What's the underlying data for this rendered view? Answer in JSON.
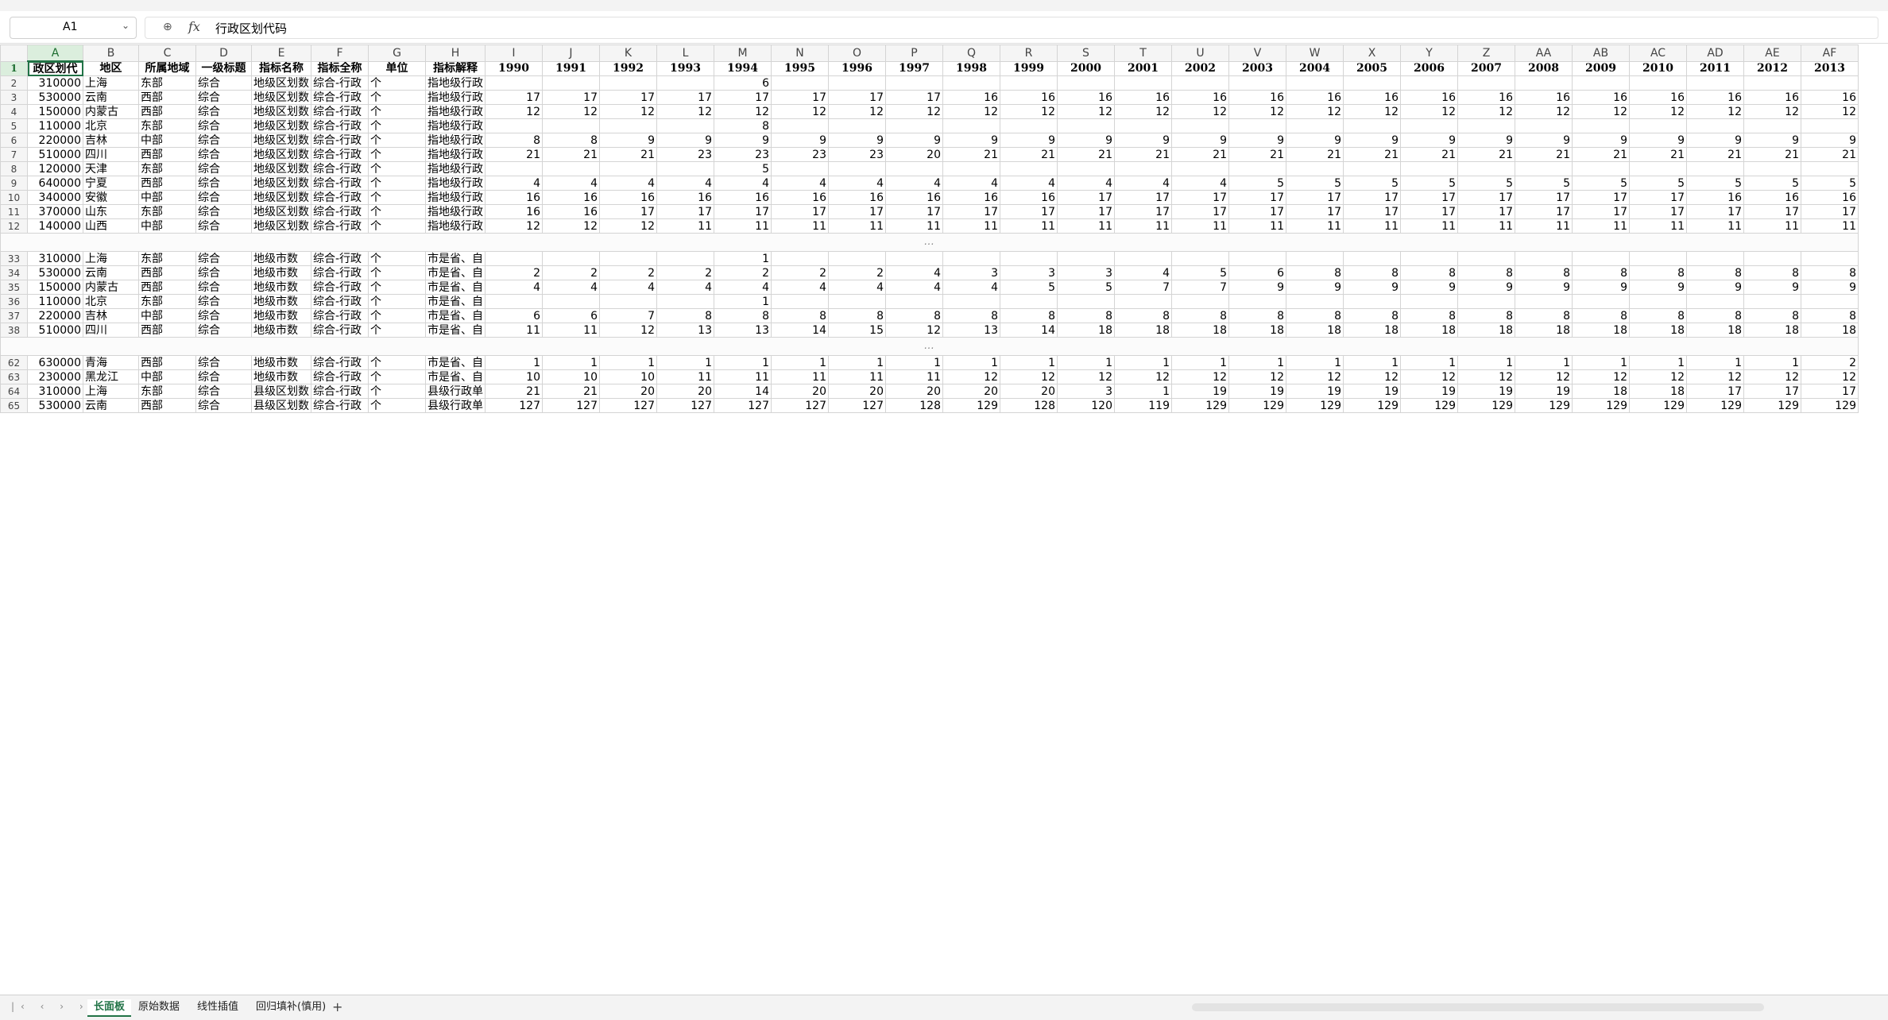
{
  "formula": {
    "cell_ref": "A1",
    "value": "行政区划代码"
  },
  "columns": [
    "A",
    "B",
    "C",
    "D",
    "E",
    "F",
    "G",
    "H",
    "I",
    "J",
    "K",
    "L",
    "M",
    "N",
    "O",
    "P",
    "Q",
    "R",
    "S",
    "T",
    "U",
    "V",
    "W",
    "X",
    "Y",
    "Z",
    "AA",
    "AB",
    "AC",
    "AD",
    "AE",
    "AF"
  ],
  "header_row": [
    "政区划代",
    "地区",
    "所属地域",
    "一级标题",
    "指标名称",
    "指标全称",
    "单位",
    "指标解释",
    "1990",
    "1991",
    "1992",
    "1993",
    "1994",
    "1995",
    "1996",
    "1997",
    "1998",
    "1999",
    "2000",
    "2001",
    "2002",
    "2003",
    "2004",
    "2005",
    "2006",
    "2007",
    "2008",
    "2009",
    "2010",
    "2011",
    "2012",
    "2013"
  ],
  "rows": [
    {
      "n": "2",
      "c": [
        "310000",
        "上海",
        "东部",
        "综合",
        "地级区划数",
        "综合-行政",
        "个",
        "指地级行政",
        "",
        "",
        "",
        "",
        "6",
        "",
        "",
        "",
        "",
        "",
        "",
        "",
        "",
        "",
        "",
        "",
        "",
        "",
        "",
        "",
        "",
        "",
        "",
        ""
      ]
    },
    {
      "n": "3",
      "c": [
        "530000",
        "云南",
        "西部",
        "综合",
        "地级区划数",
        "综合-行政",
        "个",
        "指地级行政",
        "17",
        "17",
        "17",
        "17",
        "17",
        "17",
        "17",
        "17",
        "16",
        "16",
        "16",
        "16",
        "16",
        "16",
        "16",
        "16",
        "16",
        "16",
        "16",
        "16",
        "16",
        "16",
        "16",
        "16"
      ]
    },
    {
      "n": "4",
      "c": [
        "150000",
        "内蒙古",
        "西部",
        "综合",
        "地级区划数",
        "综合-行政",
        "个",
        "指地级行政",
        "12",
        "12",
        "12",
        "12",
        "12",
        "12",
        "12",
        "12",
        "12",
        "12",
        "12",
        "12",
        "12",
        "12",
        "12",
        "12",
        "12",
        "12",
        "12",
        "12",
        "12",
        "12",
        "12",
        "12"
      ]
    },
    {
      "n": "5",
      "c": [
        "110000",
        "北京",
        "东部",
        "综合",
        "地级区划数",
        "综合-行政",
        "个",
        "指地级行政",
        "",
        "",
        "",
        "",
        "8",
        "",
        "",
        "",
        "",
        "",
        "",
        "",
        "",
        "",
        "",
        "",
        "",
        "",
        "",
        "",
        "",
        "",
        "",
        ""
      ]
    },
    {
      "n": "6",
      "c": [
        "220000",
        "吉林",
        "中部",
        "综合",
        "地级区划数",
        "综合-行政",
        "个",
        "指地级行政",
        "8",
        "8",
        "9",
        "9",
        "9",
        "9",
        "9",
        "9",
        "9",
        "9",
        "9",
        "9",
        "9",
        "9",
        "9",
        "9",
        "9",
        "9",
        "9",
        "9",
        "9",
        "9",
        "9",
        "9"
      ]
    },
    {
      "n": "7",
      "c": [
        "510000",
        "四川",
        "西部",
        "综合",
        "地级区划数",
        "综合-行政",
        "个",
        "指地级行政",
        "21",
        "21",
        "21",
        "23",
        "23",
        "23",
        "23",
        "20",
        "21",
        "21",
        "21",
        "21",
        "21",
        "21",
        "21",
        "21",
        "21",
        "21",
        "21",
        "21",
        "21",
        "21",
        "21",
        "21"
      ]
    },
    {
      "n": "8",
      "c": [
        "120000",
        "天津",
        "东部",
        "综合",
        "地级区划数",
        "综合-行政",
        "个",
        "指地级行政",
        "",
        "",
        "",
        "",
        "5",
        "",
        "",
        "",
        "",
        "",
        "",
        "",
        "",
        "",
        "",
        "",
        "",
        "",
        "",
        "",
        "",
        "",
        "",
        ""
      ]
    },
    {
      "n": "9",
      "c": [
        "640000",
        "宁夏",
        "西部",
        "综合",
        "地级区划数",
        "综合-行政",
        "个",
        "指地级行政",
        "4",
        "4",
        "4",
        "4",
        "4",
        "4",
        "4",
        "4",
        "4",
        "4",
        "4",
        "4",
        "4",
        "5",
        "5",
        "5",
        "5",
        "5",
        "5",
        "5",
        "5",
        "5",
        "5",
        "5"
      ]
    },
    {
      "n": "10",
      "c": [
        "340000",
        "安徽",
        "中部",
        "综合",
        "地级区划数",
        "综合-行政",
        "个",
        "指地级行政",
        "16",
        "16",
        "16",
        "16",
        "16",
        "16",
        "16",
        "16",
        "16",
        "16",
        "17",
        "17",
        "17",
        "17",
        "17",
        "17",
        "17",
        "17",
        "17",
        "17",
        "17",
        "16",
        "16",
        "16"
      ]
    },
    {
      "n": "11",
      "c": [
        "370000",
        "山东",
        "东部",
        "综合",
        "地级区划数",
        "综合-行政",
        "个",
        "指地级行政",
        "16",
        "16",
        "17",
        "17",
        "17",
        "17",
        "17",
        "17",
        "17",
        "17",
        "17",
        "17",
        "17",
        "17",
        "17",
        "17",
        "17",
        "17",
        "17",
        "17",
        "17",
        "17",
        "17",
        "17"
      ]
    },
    {
      "n": "12",
      "c": [
        "140000",
        "山西",
        "中部",
        "综合",
        "地级区划数",
        "综合-行政",
        "个",
        "指地级行政",
        "12",
        "12",
        "12",
        "11",
        "11",
        "11",
        "11",
        "11",
        "11",
        "11",
        "11",
        "11",
        "11",
        "11",
        "11",
        "11",
        "11",
        "11",
        "11",
        "11",
        "11",
        "11",
        "11",
        "11"
      ]
    },
    {
      "n": "33",
      "c": [
        "310000",
        "上海",
        "东部",
        "综合",
        "地级市数",
        "综合-行政",
        "个",
        "市是省、自",
        "",
        "",
        "",
        "",
        "1",
        "",
        "",
        "",
        "",
        "",
        "",
        "",
        "",
        "",
        "",
        "",
        "",
        "",
        "",
        "",
        "",
        "",
        "",
        ""
      ]
    },
    {
      "n": "34",
      "c": [
        "530000",
        "云南",
        "西部",
        "综合",
        "地级市数",
        "综合-行政",
        "个",
        "市是省、自",
        "2",
        "2",
        "2",
        "2",
        "2",
        "2",
        "2",
        "4",
        "3",
        "3",
        "3",
        "4",
        "5",
        "6",
        "8",
        "8",
        "8",
        "8",
        "8",
        "8",
        "8",
        "8",
        "8",
        "8"
      ]
    },
    {
      "n": "35",
      "c": [
        "150000",
        "内蒙古",
        "西部",
        "综合",
        "地级市数",
        "综合-行政",
        "个",
        "市是省、自",
        "4",
        "4",
        "4",
        "4",
        "4",
        "4",
        "4",
        "4",
        "4",
        "5",
        "5",
        "7",
        "7",
        "9",
        "9",
        "9",
        "9",
        "9",
        "9",
        "9",
        "9",
        "9",
        "9",
        "9"
      ]
    },
    {
      "n": "36",
      "c": [
        "110000",
        "北京",
        "东部",
        "综合",
        "地级市数",
        "综合-行政",
        "个",
        "市是省、自",
        "",
        "",
        "",
        "",
        "1",
        "",
        "",
        "",
        "",
        "",
        "",
        "",
        "",
        "",
        "",
        "",
        "",
        "",
        "",
        "",
        "",
        "",
        "",
        ""
      ]
    },
    {
      "n": "37",
      "c": [
        "220000",
        "吉林",
        "中部",
        "综合",
        "地级市数",
        "综合-行政",
        "个",
        "市是省、自",
        "6",
        "6",
        "7",
        "8",
        "8",
        "8",
        "8",
        "8",
        "8",
        "8",
        "8",
        "8",
        "8",
        "8",
        "8",
        "8",
        "8",
        "8",
        "8",
        "8",
        "8",
        "8",
        "8",
        "8"
      ]
    },
    {
      "n": "38",
      "c": [
        "510000",
        "四川",
        "西部",
        "综合",
        "地级市数",
        "综合-行政",
        "个",
        "市是省、自",
        "11",
        "11",
        "12",
        "13",
        "13",
        "14",
        "15",
        "12",
        "13",
        "14",
        "18",
        "18",
        "18",
        "18",
        "18",
        "18",
        "18",
        "18",
        "18",
        "18",
        "18",
        "18",
        "18",
        "18"
      ]
    },
    {
      "n": "62",
      "c": [
        "630000",
        "青海",
        "西部",
        "综合",
        "地级市数",
        "综合-行政",
        "个",
        "市是省、自",
        "1",
        "1",
        "1",
        "1",
        "1",
        "1",
        "1",
        "1",
        "1",
        "1",
        "1",
        "1",
        "1",
        "1",
        "1",
        "1",
        "1",
        "1",
        "1",
        "1",
        "1",
        "1",
        "1",
        "2"
      ]
    },
    {
      "n": "63",
      "c": [
        "230000",
        "黑龙江",
        "中部",
        "综合",
        "地级市数",
        "综合-行政",
        "个",
        "市是省、自",
        "10",
        "10",
        "10",
        "11",
        "11",
        "11",
        "11",
        "11",
        "12",
        "12",
        "12",
        "12",
        "12",
        "12",
        "12",
        "12",
        "12",
        "12",
        "12",
        "12",
        "12",
        "12",
        "12",
        "12"
      ]
    },
    {
      "n": "64",
      "c": [
        "310000",
        "上海",
        "东部",
        "综合",
        "县级区划数",
        "综合-行政",
        "个",
        "县级行政单",
        "21",
        "21",
        "20",
        "20",
        "14",
        "20",
        "20",
        "20",
        "20",
        "20",
        "3",
        "1",
        "19",
        "19",
        "19",
        "19",
        "19",
        "19",
        "19",
        "18",
        "18",
        "17",
        "17",
        "17"
      ]
    },
    {
      "n": "65",
      "c": [
        "530000",
        "云南",
        "西部",
        "综合",
        "县级区划数",
        "综合-行政",
        "个",
        "县级行政单",
        "127",
        "127",
        "127",
        "127",
        "127",
        "127",
        "127",
        "128",
        "129",
        "128",
        "120",
        "119",
        "129",
        "129",
        "129",
        "129",
        "129",
        "129",
        "129",
        "129",
        "129",
        "129",
        "129",
        "129"
      ]
    }
  ],
  "omitted_note": "…",
  "sheet_tabs": [
    "长面板",
    "原始数据",
    "线性插值",
    "回归填补(慎用)"
  ],
  "add_tab": "+",
  "nav_arrows": "|‹ ‹ › ›|"
}
